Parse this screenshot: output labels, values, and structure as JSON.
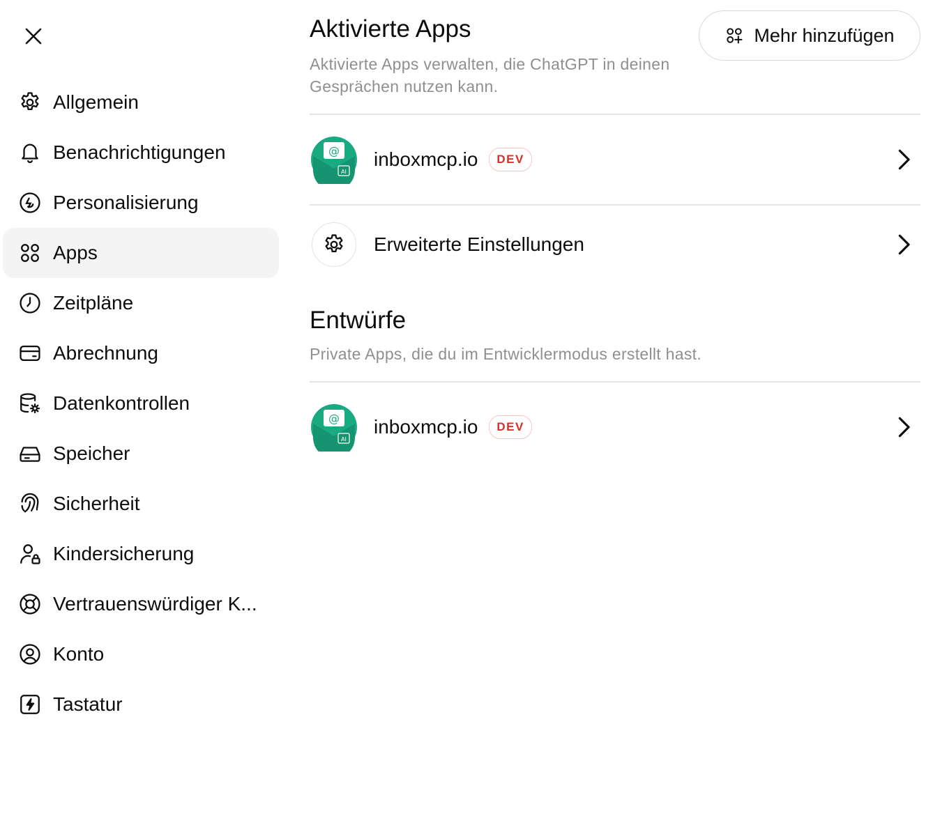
{
  "sidebar": {
    "close_icon": "close-icon",
    "active": "apps",
    "items": [
      {
        "label": "Allgemein",
        "icon": "gear-icon"
      },
      {
        "label": "Benachrichtigungen",
        "icon": "bell-icon"
      },
      {
        "label": "Personalisierung",
        "icon": "personalize-icon"
      },
      {
        "label": "Apps",
        "icon": "apps-grid-icon"
      },
      {
        "label": "Zeitpläne",
        "icon": "clock-icon"
      },
      {
        "label": "Abrechnung",
        "icon": "credit-card-icon"
      },
      {
        "label": "Datenkontrollen",
        "icon": "database-gear-icon"
      },
      {
        "label": "Speicher",
        "icon": "storage-drive-icon"
      },
      {
        "label": "Sicherheit",
        "icon": "fingerprint-icon"
      },
      {
        "label": "Kindersicherung",
        "icon": "user-lock-icon"
      },
      {
        "label": "Vertrauenswürdiger K...",
        "icon": "lifebuoy-icon"
      },
      {
        "label": "Konto",
        "icon": "user-circle-icon"
      },
      {
        "label": "Tastatur",
        "icon": "lightning-box-icon"
      }
    ]
  },
  "main": {
    "enabled": {
      "title": "Aktivierte Apps",
      "description": "Aktivierte Apps verwalten, die ChatGPT in deinen Gesprächen nutzen kann.",
      "add_button": "Mehr hinzufügen",
      "apps": [
        {
          "name": "inboxmcp.io",
          "badge": "DEV"
        }
      ],
      "advanced_label": "Erweiterte Einstellungen"
    },
    "drafts": {
      "title": "Entwürfe",
      "description": "Private Apps, die du im Entwicklermodus erstellt hast.",
      "apps": [
        {
          "name": "inboxmcp.io",
          "badge": "DEV"
        }
      ]
    }
  },
  "colors": {
    "app_icon": "#1aa981",
    "badge_text": "#d93025",
    "active_bg": "#f4f4f4"
  }
}
